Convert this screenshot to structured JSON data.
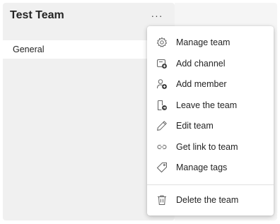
{
  "team": {
    "name": "Test Team",
    "more_label": "···"
  },
  "channels": [
    {
      "label": "General"
    }
  ],
  "menu": {
    "items": [
      {
        "label": "Manage team",
        "icon": "gear-icon"
      },
      {
        "label": "Add channel",
        "icon": "add-channel-icon"
      },
      {
        "label": "Add member",
        "icon": "add-member-icon"
      },
      {
        "label": "Leave the team",
        "icon": "leave-team-icon"
      },
      {
        "label": "Edit team",
        "icon": "pencil-icon"
      },
      {
        "label": "Get link to team",
        "icon": "link-icon"
      },
      {
        "label": "Manage tags",
        "icon": "tag-icon"
      }
    ],
    "delete_item": {
      "label": "Delete the team",
      "icon": "trash-icon"
    }
  }
}
